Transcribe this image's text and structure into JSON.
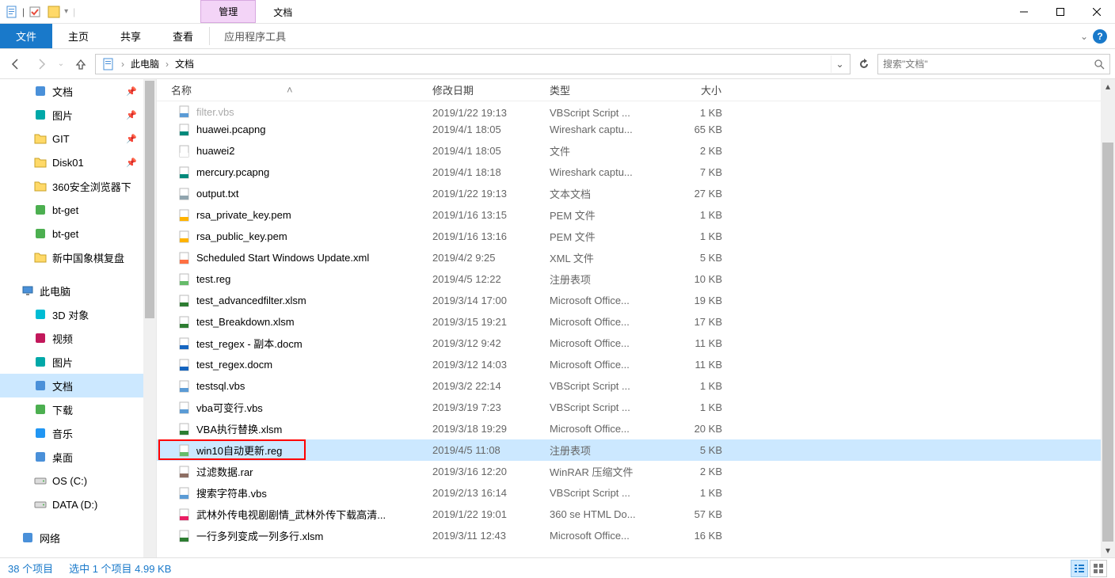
{
  "titlebar": {
    "context_tab": "管理",
    "plain_tab": "文档"
  },
  "ribbon": {
    "file": "文件",
    "tabs": [
      "主页",
      "共享",
      "查看"
    ],
    "context_label": "应用程序工具"
  },
  "address": {
    "crumbs": [
      "此电脑",
      "文档"
    ]
  },
  "search": {
    "placeholder": "搜索\"文档\""
  },
  "nav_items": [
    {
      "icon": "doc",
      "label": "文档",
      "pin": true
    },
    {
      "icon": "pic",
      "label": "图片",
      "pin": true
    },
    {
      "icon": "folder",
      "label": "GIT",
      "pin": true
    },
    {
      "icon": "folder",
      "label": "Disk01",
      "pin": true
    },
    {
      "icon": "folder",
      "label": "360安全浏览器下"
    },
    {
      "icon": "green",
      "label": "bt-get"
    },
    {
      "icon": "green",
      "label": "bt-get"
    },
    {
      "icon": "folder",
      "label": "新中国象棋复盘"
    },
    {
      "spacer": true
    },
    {
      "icon": "pc",
      "label": "此电脑",
      "hdr": true
    },
    {
      "icon": "3d",
      "label": "3D 对象"
    },
    {
      "icon": "video",
      "label": "视频"
    },
    {
      "icon": "pic",
      "label": "图片"
    },
    {
      "icon": "doc",
      "label": "文档",
      "sel": true
    },
    {
      "icon": "dl",
      "label": "下载"
    },
    {
      "icon": "music",
      "label": "音乐"
    },
    {
      "icon": "desk",
      "label": "桌面"
    },
    {
      "icon": "drive",
      "label": "OS (C:)"
    },
    {
      "icon": "drive",
      "label": "DATA (D:)"
    },
    {
      "spacer": true
    },
    {
      "icon": "net",
      "label": "网络",
      "hdr": true
    }
  ],
  "columns": {
    "name": "名称",
    "date": "修改日期",
    "type": "类型",
    "size": "大小"
  },
  "files": [
    {
      "icon": "vbs",
      "name": "filter.vbs",
      "date": "2019/1/22 19:13",
      "type": "VBScript Script ...",
      "size": "1 KB",
      "cut": true
    },
    {
      "icon": "pcap",
      "name": "huawei.pcapng",
      "date": "2019/4/1 18:05",
      "type": "Wireshark captu...",
      "size": "65 KB"
    },
    {
      "icon": "file",
      "name": "huawei2",
      "date": "2019/4/1 18:05",
      "type": "文件",
      "size": "2 KB"
    },
    {
      "icon": "pcap",
      "name": "mercury.pcapng",
      "date": "2019/4/1 18:18",
      "type": "Wireshark captu...",
      "size": "7 KB"
    },
    {
      "icon": "txt",
      "name": "output.txt",
      "date": "2019/1/22 19:13",
      "type": "文本文档",
      "size": "27 KB"
    },
    {
      "icon": "key",
      "name": "rsa_private_key.pem",
      "date": "2019/1/16 13:15",
      "type": "PEM 文件",
      "size": "1 KB"
    },
    {
      "icon": "key",
      "name": "rsa_public_key.pem",
      "date": "2019/1/16 13:16",
      "type": "PEM 文件",
      "size": "1 KB"
    },
    {
      "icon": "xml",
      "name": "Scheduled Start Windows Update.xml",
      "date": "2019/4/2 9:25",
      "type": "XML 文件",
      "size": "5 KB"
    },
    {
      "icon": "reg",
      "name": "test.reg",
      "date": "2019/4/5 12:22",
      "type": "注册表项",
      "size": "10 KB"
    },
    {
      "icon": "xlsm",
      "name": "test_advancedfilter.xlsm",
      "date": "2019/3/14 17:00",
      "type": "Microsoft Office...",
      "size": "19 KB"
    },
    {
      "icon": "xlsm",
      "name": "test_Breakdown.xlsm",
      "date": "2019/3/15 19:21",
      "type": "Microsoft Office...",
      "size": "17 KB"
    },
    {
      "icon": "docm",
      "name": "test_regex - 副本.docm",
      "date": "2019/3/12 9:42",
      "type": "Microsoft Office...",
      "size": "11 KB"
    },
    {
      "icon": "docm",
      "name": "test_regex.docm",
      "date": "2019/3/12 14:03",
      "type": "Microsoft Office...",
      "size": "11 KB"
    },
    {
      "icon": "vbs",
      "name": "testsql.vbs",
      "date": "2019/3/2 22:14",
      "type": "VBScript Script ...",
      "size": "1 KB"
    },
    {
      "icon": "vbs",
      "name": "vba可变行.vbs",
      "date": "2019/3/19 7:23",
      "type": "VBScript Script ...",
      "size": "1 KB"
    },
    {
      "icon": "xlsm",
      "name": "VBA执行替换.xlsm",
      "date": "2019/3/18 19:29",
      "type": "Microsoft Office...",
      "size": "20 KB"
    },
    {
      "icon": "reg",
      "name": "win10自动更新.reg",
      "date": "2019/4/5 11:08",
      "type": "注册表项",
      "size": "5 KB",
      "sel": true,
      "highlight": true
    },
    {
      "icon": "rar",
      "name": "过滤数据.rar",
      "date": "2019/3/16 12:20",
      "type": "WinRAR 压缩文件",
      "size": "2 KB"
    },
    {
      "icon": "vbs",
      "name": "搜索字符串.vbs",
      "date": "2019/2/13 16:14",
      "type": "VBScript Script ...",
      "size": "1 KB"
    },
    {
      "icon": "html",
      "name": "武林外传电视剧剧情_武林外传下载高清...",
      "date": "2019/1/22 19:01",
      "type": "360 se HTML Do...",
      "size": "57 KB"
    },
    {
      "icon": "xlsm",
      "name": "一行多列变成一列多行.xlsm",
      "date": "2019/3/11 12:43",
      "type": "Microsoft Office...",
      "size": "16 KB"
    }
  ],
  "status": {
    "count": "38 个项目",
    "sel": "选中 1 个项目 4.99 KB"
  }
}
